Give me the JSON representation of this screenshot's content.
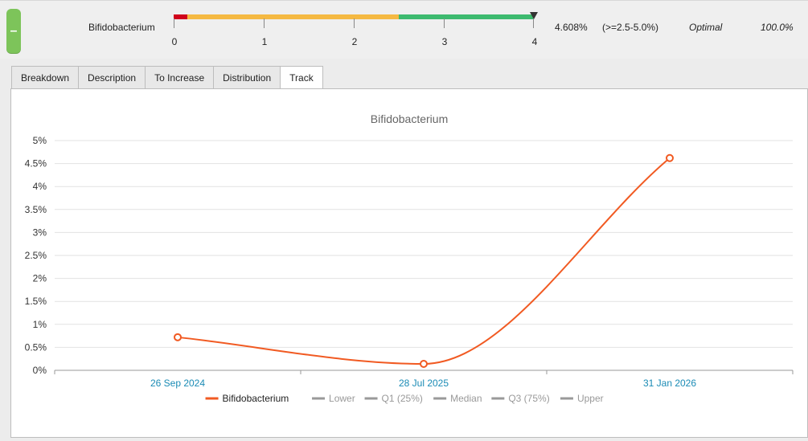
{
  "organism": {
    "name": "Bifidobacterium",
    "value": "4.608%",
    "range": "(>=2.5-5.0%)",
    "status": "Optimal",
    "percentile": "100.0%"
  },
  "toggle": {
    "label": "–"
  },
  "gauge": {
    "ticks": [
      "0",
      "1",
      "2",
      "3",
      "4"
    ],
    "segments": [
      {
        "from": 0,
        "to": 0.15,
        "color": "#d0021b"
      },
      {
        "from": 0.15,
        "to": 2.5,
        "color": "#f5b942"
      },
      {
        "from": 2.5,
        "to": 4,
        "color": "#3dba6f"
      }
    ],
    "marker": 4.0
  },
  "tabs": [
    {
      "label": "Breakdown",
      "active": false
    },
    {
      "label": "Description",
      "active": false
    },
    {
      "label": "To Increase",
      "active": false
    },
    {
      "label": "Distribution",
      "active": false
    },
    {
      "label": "Track",
      "active": true
    }
  ],
  "chart_data": {
    "type": "line",
    "title": "Bifidobacterium",
    "x": [
      "26 Sep 2024",
      "28 Jul 2025",
      "31 Jan 2026"
    ],
    "series": [
      {
        "name": "Bifidobacterium",
        "values": [
          0.72,
          0.14,
          4.62
        ],
        "color": "#f15a22"
      }
    ],
    "y_ticks": [
      "0%",
      "0.5%",
      "1%",
      "1.5%",
      "2%",
      "2.5%",
      "3%",
      "3.5%",
      "4%",
      "4.5%",
      "5%"
    ],
    "ylim": [
      0,
      5
    ],
    "grid": true,
    "legend_position": "bottom",
    "legend": [
      {
        "label": "Bifidobacterium",
        "color": "#f15a22"
      },
      {
        "label": "Lower",
        "color": "#999999"
      },
      {
        "label": "Q1 (25%)",
        "color": "#999999"
      },
      {
        "label": "Median",
        "color": "#999999"
      },
      {
        "label": "Q3 (75%)",
        "color": "#999999"
      },
      {
        "label": "Upper",
        "color": "#999999"
      }
    ]
  }
}
